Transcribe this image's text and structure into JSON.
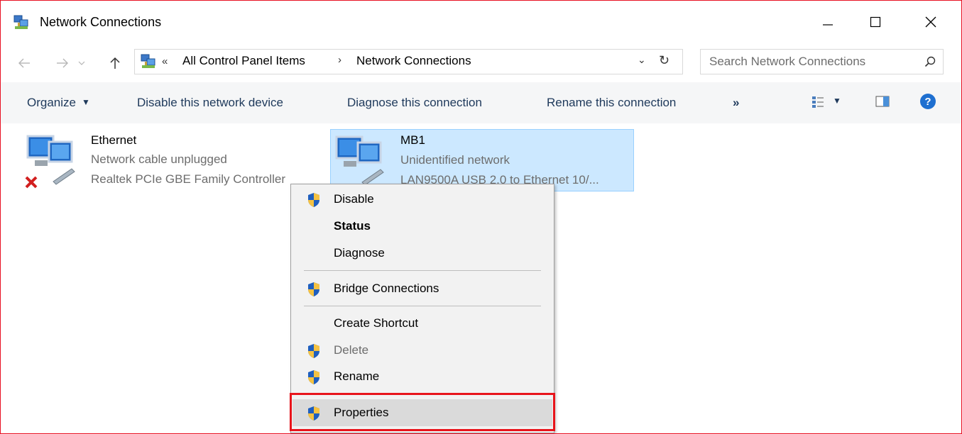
{
  "window": {
    "title": "Network Connections",
    "accent_border": "#e81123"
  },
  "address": {
    "overflow_chevron": "«",
    "crumbs": [
      "All Control Panel Items",
      "Network Connections"
    ],
    "separator": "›",
    "dropdown": "⌄",
    "refresh": "↻"
  },
  "search": {
    "placeholder": "Search Network Connections"
  },
  "commands": {
    "organize": "Organize",
    "disable_device": "Disable this network device",
    "diagnose": "Diagnose this connection",
    "rename": "Rename this connection",
    "more": "»"
  },
  "connections": [
    {
      "name": "Ethernet",
      "status": "Network cable unplugged",
      "adapter": "Realtek PCIe GBE Family Controller",
      "disconnected": true,
      "selected": false
    },
    {
      "name": "MB1",
      "status": "Unidentified network",
      "adapter": "LAN9500A USB 2.0 to Ethernet 10/...",
      "disconnected": false,
      "selected": true
    }
  ],
  "context_menu": {
    "items": [
      {
        "label": "Disable",
        "shield": true,
        "bold": false,
        "disabled": false
      },
      {
        "label": "Status",
        "shield": false,
        "bold": true,
        "disabled": false
      },
      {
        "label": "Diagnose",
        "shield": false,
        "bold": false,
        "disabled": false
      },
      {
        "label": "Bridge Connections",
        "shield": true,
        "bold": false,
        "disabled": false
      },
      {
        "label": "Create Shortcut",
        "shield": false,
        "bold": false,
        "disabled": false
      },
      {
        "label": "Delete",
        "shield": true,
        "bold": false,
        "disabled": true
      },
      {
        "label": "Rename",
        "shield": true,
        "bold": false,
        "disabled": false
      },
      {
        "label": "Properties",
        "shield": true,
        "bold": false,
        "disabled": false,
        "highlighted": true
      }
    ],
    "highlight_color": "#e8141b"
  },
  "colors": {
    "selection": "#cce8ff",
    "command_text": "#1e395b"
  },
  "icons": [
    "network-connections-icon",
    "back-arrow-icon",
    "forward-arrow-icon",
    "recent-dropdown-icon",
    "up-arrow-icon",
    "search-icon",
    "view-options-icon",
    "preview-pane-icon",
    "help-icon",
    "uac-shield-icon",
    "network-adapter-icon",
    "disconnected-x-icon"
  ]
}
